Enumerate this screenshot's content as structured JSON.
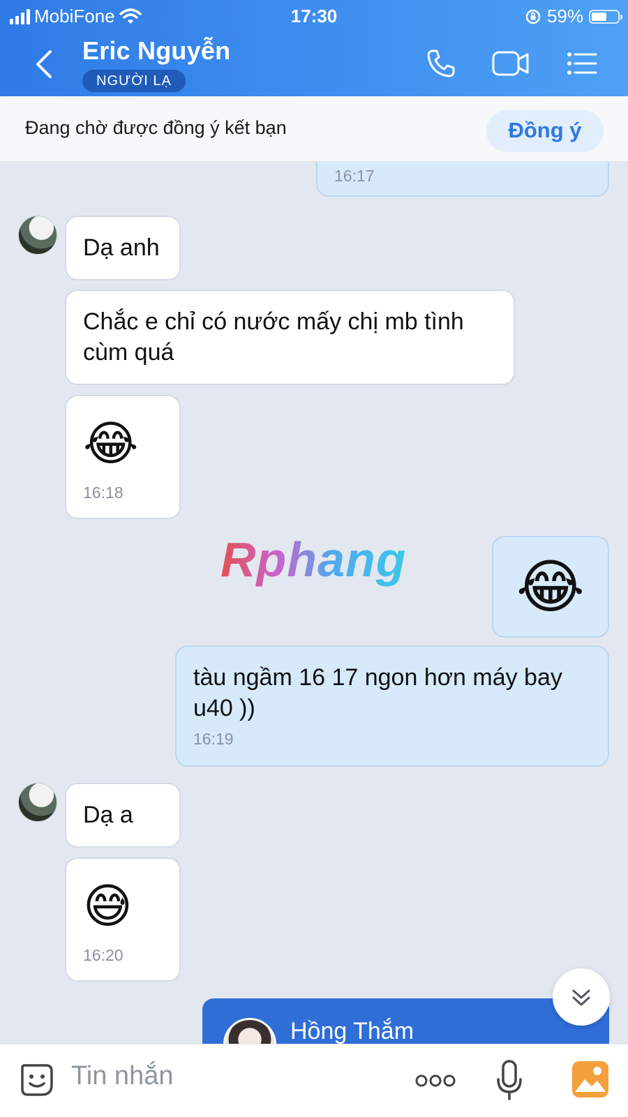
{
  "status_bar": {
    "carrier": "MobiFone",
    "time": "17:30",
    "battery": "59%",
    "battery_level": 0.59
  },
  "header": {
    "contact_name": "Eric Nguyễn",
    "badge": "NGƯỜI LẠ",
    "icons": [
      "back-icon",
      "phone-icon",
      "video-icon",
      "menu-icon"
    ]
  },
  "friend_request": {
    "text": "Đang chờ được đồng ý kết bạn",
    "accept_label": "Đồng ý"
  },
  "messages": [
    {
      "from": "me",
      "time": "16:17"
    },
    {
      "from": "other",
      "text": "Dạ anh"
    },
    {
      "from": "other",
      "text": "Chắc e chỉ có nước mấy chị mb tình cùm quá"
    },
    {
      "from": "other",
      "emoji": "😂",
      "time": "16:18"
    },
    {
      "from": "me",
      "emoji": "😂"
    },
    {
      "from": "me",
      "text": "tàu ngầm 16 17 ngon hơn máy bay u40 ))",
      "time": "16:19"
    },
    {
      "from": "other",
      "text": "Dạ a"
    },
    {
      "from": "other",
      "emoji": "😅",
      "time": "16:20"
    }
  ],
  "watermark": "Rphang",
  "shared_contact": {
    "name": "Hồng Thắm"
  },
  "input": {
    "placeholder": "Tin nhắn",
    "icons": [
      "sticker-icon",
      "more-icon",
      "mic-icon",
      "image-icon"
    ]
  },
  "colors": {
    "header": "#3a89ee",
    "my_bubble": "#d6eafb",
    "other_bubble": "#ffffff",
    "accent": "#2f78e0"
  }
}
